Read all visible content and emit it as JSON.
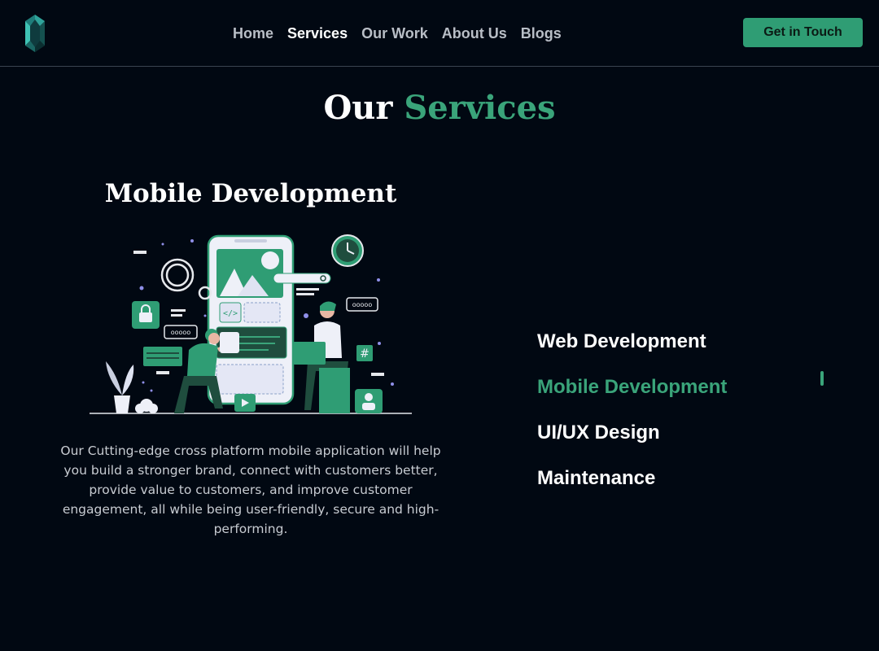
{
  "header": {
    "nav": [
      {
        "label": "Home",
        "active": false
      },
      {
        "label": "Services",
        "active": true
      },
      {
        "label": "Our Work",
        "active": false
      },
      {
        "label": "About Us",
        "active": false
      },
      {
        "label": "Blogs",
        "active": false
      }
    ],
    "cta_label": "Get in Touch"
  },
  "section": {
    "title_plain": "Our",
    "title_accent": "Services"
  },
  "selected_service": {
    "title": "Mobile Development",
    "illustration": "mobile-development-illustration",
    "description": "Our Cutting-edge cross platform mobile application will help you build a stronger brand, connect with customers better, provide value to customers, and improve customer engagement, all while being user-friendly, secure and high-performing."
  },
  "services": [
    {
      "label": "Web Development",
      "active": false
    },
    {
      "label": "Mobile Development",
      "active": true
    },
    {
      "label": "UI/UX Design",
      "active": false
    },
    {
      "label": "Maintenance",
      "active": false
    }
  ],
  "colors": {
    "background": "#010812",
    "accent": "#3aa47a",
    "button": "#2f9d74",
    "nav_inactive": "#b9bec6"
  },
  "icons": [
    "logo-icon",
    "lock-icon",
    "gear-icon",
    "clock-icon",
    "search-icon",
    "code-icon",
    "hashtag-icon",
    "play-icon",
    "user-icon",
    "chat-bubble-icon",
    "plant-icon",
    "cloud-icon"
  ]
}
